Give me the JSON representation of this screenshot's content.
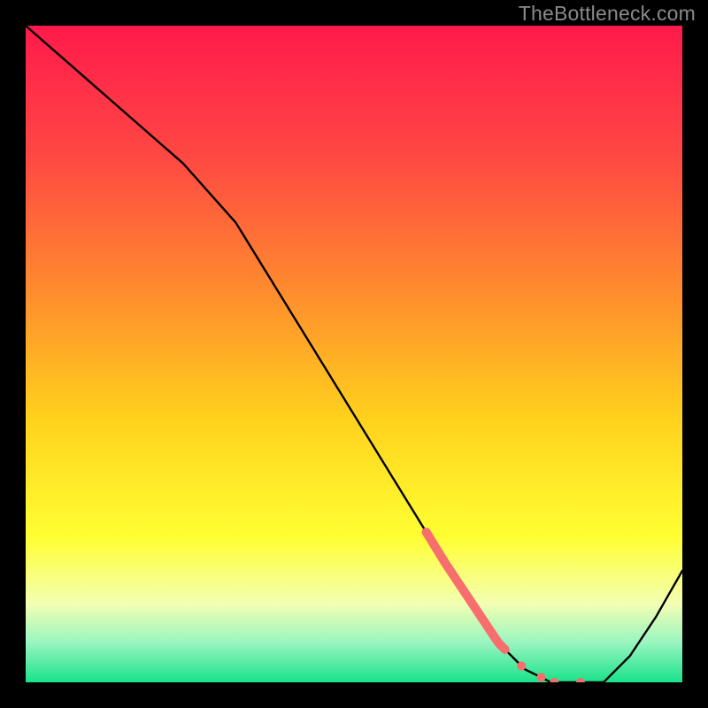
{
  "watermark": "TheBottleneck.com",
  "chart_data": {
    "type": "line",
    "title": "",
    "xlabel": "",
    "ylabel": "",
    "xlim": [
      0,
      100
    ],
    "ylim": [
      0,
      100
    ],
    "x": [
      0,
      8,
      16,
      24,
      32,
      40,
      48,
      56,
      64,
      72,
      76,
      80,
      84,
      88,
      92,
      96,
      100
    ],
    "values": [
      100,
      93,
      86,
      79,
      70,
      57,
      44,
      31,
      18,
      6,
      2,
      0,
      0,
      0,
      4,
      10,
      17
    ],
    "gradient_stops": [
      {
        "offset": 0.0,
        "color": "#ff1a4b"
      },
      {
        "offset": 0.2,
        "color": "#ff4843"
      },
      {
        "offset": 0.4,
        "color": "#ff8a2e"
      },
      {
        "offset": 0.6,
        "color": "#ffd21c"
      },
      {
        "offset": 0.78,
        "color": "#ffff33"
      },
      {
        "offset": 0.88,
        "color": "#f3ffb2"
      },
      {
        "offset": 0.94,
        "color": "#98f5c0"
      },
      {
        "offset": 1.0,
        "color": "#19e28a"
      }
    ],
    "highlight_band_x": [
      61,
      73
    ],
    "highlight_dots_x": [
      75.5,
      78.5,
      80.5,
      84.5
    ]
  }
}
